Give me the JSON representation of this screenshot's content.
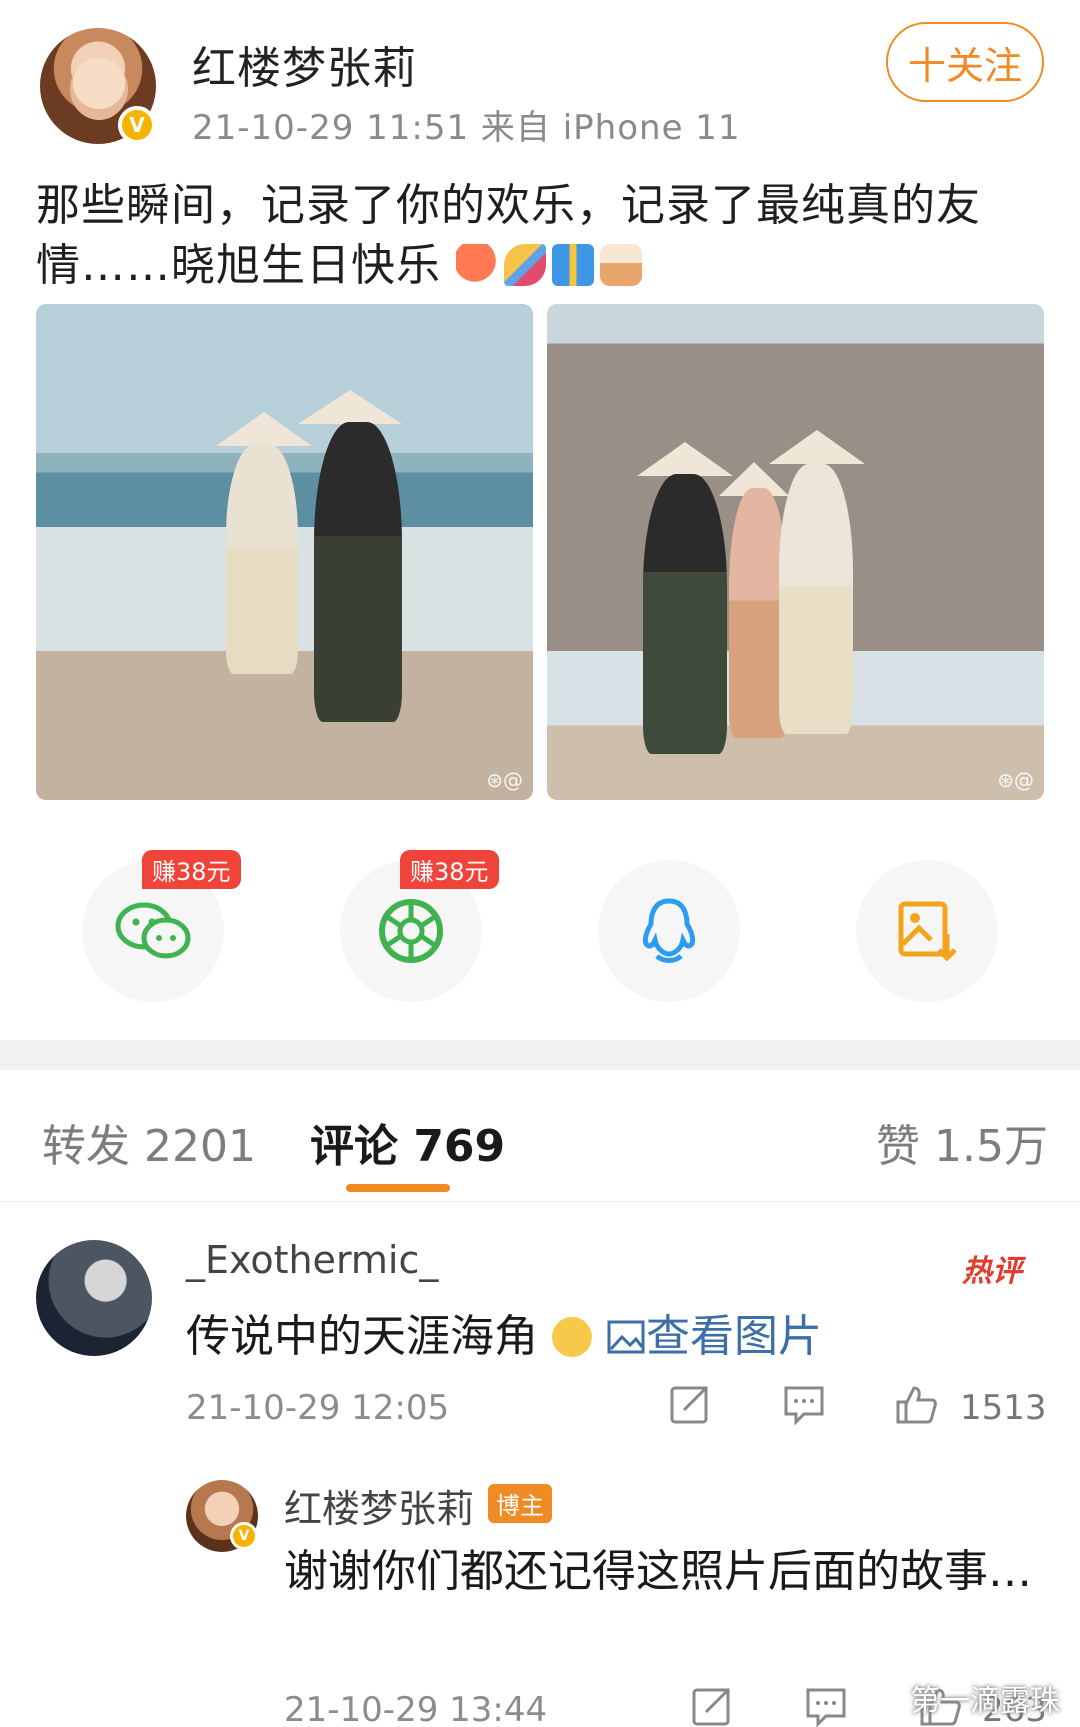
{
  "post": {
    "author": "红楼梦张莉",
    "meta": "21-10-29 11:51   来自 iPhone 11",
    "follow_label": "十关注",
    "text": "那些瞬间，记录了你的欢乐，记录了最纯真的友情……晓旭生日快乐",
    "emojis": [
      "balloon-emoji",
      "party-popper-emoji",
      "gift-emoji",
      "birthday-cake-emoji"
    ],
    "photo_watermark": "⊛@"
  },
  "share": {
    "earn_label": "赚38元",
    "targets": [
      "wechat-icon",
      "moments-icon",
      "qq-icon",
      "save-image-icon"
    ]
  },
  "tabs": {
    "repost": "转发 2201",
    "comments": "评论 769",
    "likes": "赞 1.5万"
  },
  "comment1": {
    "user": "_Exothermic_",
    "badge": "热评",
    "text": "传说中的天涯海角",
    "see_picture": "查看图片",
    "time": "21-10-29 12:05",
    "likes": "1513"
  },
  "reply1": {
    "user": "红楼梦张莉",
    "badge": "博主",
    "text": "谢谢你们都还记得这照片后面的故事…",
    "time": "21-10-29 13:44",
    "likes": "263"
  },
  "watermark": "第一滴露珠",
  "colors": {
    "accent": "#f08a24",
    "link": "#3c6ea8",
    "hot": "#e23b2f",
    "earn": "#f0443b",
    "wechat": "#3fb34f",
    "qq": "#2b9cf0",
    "save": "#f2a51a"
  }
}
